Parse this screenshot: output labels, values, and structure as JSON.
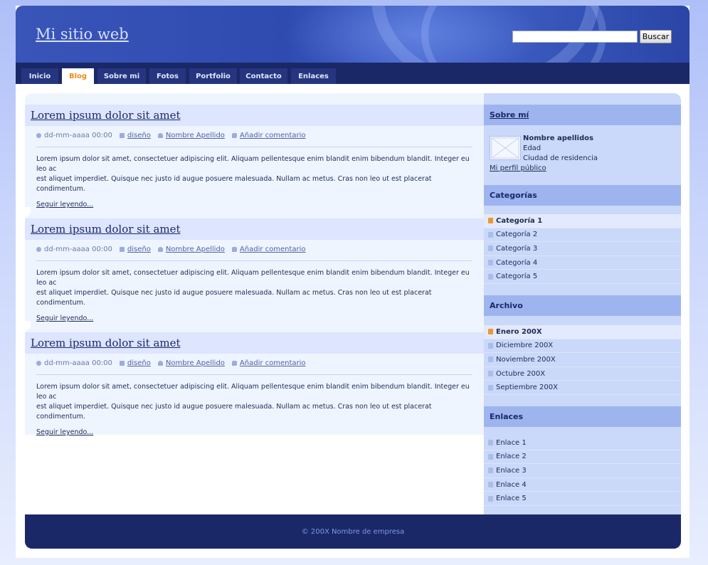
{
  "header": {
    "site_title": "Mi sitio web",
    "search_button": "Buscar",
    "search_value": ""
  },
  "nav": {
    "tabs": [
      {
        "label": "Inicio",
        "active": false
      },
      {
        "label": "Blog",
        "active": true
      },
      {
        "label": "Sobre mi",
        "active": false
      },
      {
        "label": "Fotos",
        "active": false
      },
      {
        "label": "Portfolio",
        "active": false
      },
      {
        "label": "Contacto",
        "active": false
      },
      {
        "label": "Enlaces",
        "active": false
      }
    ]
  },
  "posts": [
    {
      "title": "Lorem ipsum dolor sit amet",
      "date": "dd-mm-aaaa 00:00",
      "category": "diseño",
      "author": "Nombre Apellido",
      "comment_link": "Añadir comentario",
      "excerpt_line1": "Lorem ipsum dolor sit amet, consectetuer adipiscing elit. Aliquam pellentesque enim blandit enim bibendum blandit. Integer eu leo ac",
      "excerpt_line2": "est aliquet imperdiet. Quisque nec justo id augue posuere malesuada. Nullam ac metus. Cras non leo ut est placerat condimentum.",
      "read_more": "Seguir leyendo..."
    },
    {
      "title": "Lorem ipsum dolor sit amet",
      "date": "dd-mm-aaaa 00:00",
      "category": "diseño",
      "author": "Nombre Apellido",
      "comment_link": "Añadir comentario",
      "excerpt_line1": "Lorem ipsum dolor sit amet, consectetuer adipiscing elit. Aliquam pellentesque enim blandit enim bibendum blandit. Integer eu leo ac",
      "excerpt_line2": "est aliquet imperdiet. Quisque nec justo id augue posuere malesuada. Nullam ac metus. Cras non leo ut est placerat condimentum.",
      "read_more": "Seguir leyendo..."
    },
    {
      "title": "Lorem ipsum dolor sit amet",
      "date": "dd-mm-aaaa 00:00",
      "category": "diseño",
      "author": "Nombre Apellido",
      "comment_link": "Añadir comentario",
      "excerpt_line1": "Lorem ipsum dolor sit amet, consectetuer adipiscing elit. Aliquam pellentesque enim blandit enim bibendum blandit. Integer eu leo ac",
      "excerpt_line2": "est aliquet imperdiet. Quisque nec justo id augue posuere malesuada. Nullam ac metus. Cras non leo ut est placerat condimentum.",
      "read_more": "Seguir leyendo..."
    }
  ],
  "sidebar": {
    "about": {
      "heading": "Sobre mí",
      "name": "Nombre apellidos",
      "age": "Edad",
      "city": "Ciudad de residencia",
      "profile_link": "Mi perfil público"
    },
    "categories": {
      "heading": "Categorías",
      "items": [
        "Categoría 1",
        "Categoría 2",
        "Categoría 3",
        "Categoría 4",
        "Categoría 5"
      ],
      "active_index": 0
    },
    "archive": {
      "heading": "Archivo",
      "items": [
        "Enero 200X",
        "Diciembre 200X",
        "Noviembre 200X",
        "Octubre 200X",
        "Septiembre 200X"
      ],
      "active_index": 0
    },
    "links": {
      "heading": "Enlaces",
      "items": [
        "Enlace 1",
        "Enlace 2",
        "Enlace 3",
        "Enlace 4",
        "Enlace 5"
      ]
    }
  },
  "footer": {
    "text": "© 200X Nombre de empresa"
  },
  "colors": {
    "nav_bg": "#1b2868",
    "active_tab_text": "#f08a1a",
    "sidebar_bg": "#cad8f9",
    "sidebar_heading_bg": "#9db4ee",
    "post_bg": "#eef5ff",
    "post_title_bg": "#dde5ff"
  }
}
